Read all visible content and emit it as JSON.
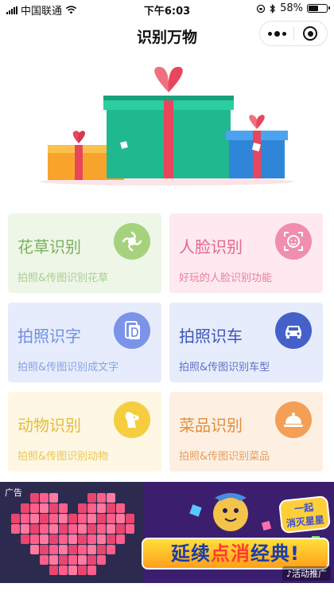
{
  "status_bar": {
    "carrier": "中国联通",
    "time": "下午6:03",
    "battery": "58%",
    "battery_level": 0.58
  },
  "nav": {
    "title": "识别万物"
  },
  "cards": [
    {
      "title": "花草识别",
      "subtitle": "拍照&传图识别花草",
      "icon": "flower-icon",
      "title_color": "#7ab15a",
      "sub_color": "#a9cf8f",
      "bg": "#eef6e8",
      "icon_bg": "#a6d27e"
    },
    {
      "title": "人脸识别",
      "subtitle": "好玩的人脸识别功能",
      "icon": "face-icon",
      "title_color": "#e6668d",
      "sub_color": "#ec7d9c",
      "bg": "#fde9ef",
      "icon_bg": "#f08db0"
    },
    {
      "title": "拍照识字",
      "subtitle": "拍照&传图识别成文字",
      "icon": "document-icon",
      "title_color": "#6f8fe0",
      "sub_color": "#86a2e6",
      "bg": "#e6ecfb",
      "icon_bg": "#7b93e9"
    },
    {
      "title": "拍照识车",
      "subtitle": "拍照&传图识别车型",
      "icon": "car-icon",
      "title_color": "#3d55b8",
      "sub_color": "#5f72c6",
      "bg": "#e6ecfb",
      "icon_bg": "#4561c9"
    },
    {
      "title": "动物识别",
      "subtitle": "拍照&传图识别动物",
      "icon": "dog-icon",
      "title_color": "#e6bc3a",
      "sub_color": "#ecc752",
      "bg": "#fdf7e3",
      "icon_bg": "#f5cd3f"
    },
    {
      "title": "菜品识别",
      "subtitle": "拍照&传图识别菜品",
      "icon": "dish-icon",
      "title_color": "#e48d3c",
      "sub_color": "#e59d5a",
      "bg": "#fdf0e3",
      "icon_bg": "#f39f55"
    }
  ],
  "ad": {
    "label": "广告",
    "slogan_a": "延续",
    "slogan_b": "点消",
    "slogan_c": "经典!",
    "game_name_line1": "一起",
    "game_name_line2": "消灭星星",
    "tag": "活动推广"
  }
}
